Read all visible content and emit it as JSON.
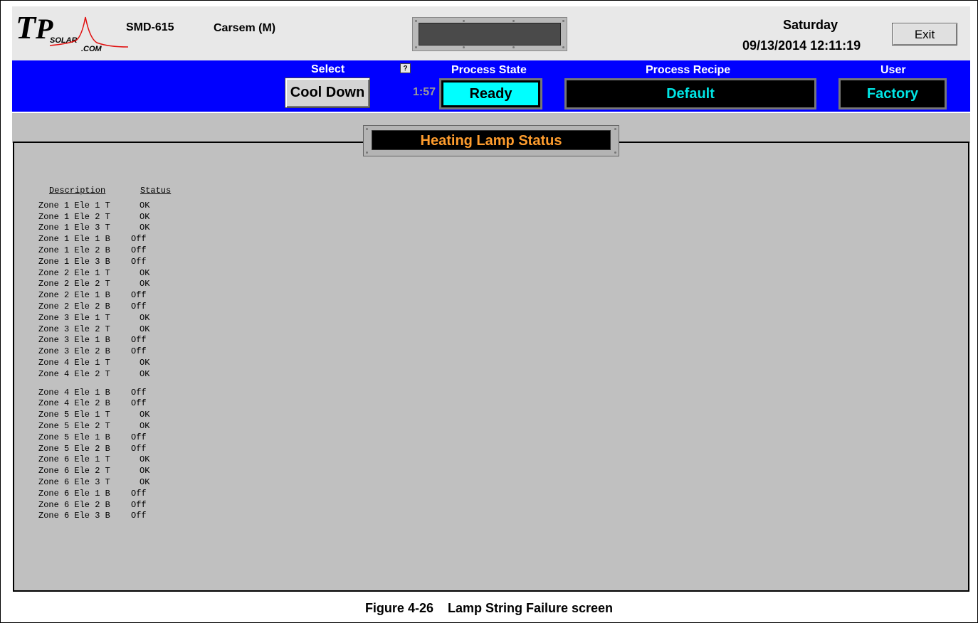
{
  "header": {
    "logo_alt": "TP SOLAR .COM",
    "model": "SMD-615",
    "site": "Carsem (M)",
    "day": "Saturday",
    "datetime": "09/13/2014 12:11:19",
    "exit_label": "Exit"
  },
  "statusbar": {
    "select_label": "Select",
    "select_button": "Cool Down",
    "help_label": "?",
    "timer": "1:57",
    "process_state_label": "Process State",
    "process_state_value": "Ready",
    "process_recipe_label": "Process Recipe",
    "process_recipe_value": "Default",
    "user_label": "User",
    "user_value": "Factory"
  },
  "panel": {
    "title": "Heating Lamp Status",
    "columns": {
      "description": "Description",
      "status": "Status"
    },
    "rows": [
      {
        "d": "Zone 1 Ele 1 T",
        "s": "OK"
      },
      {
        "d": "Zone 1 Ele 2 T",
        "s": "OK"
      },
      {
        "d": "Zone 1 Ele 3 T",
        "s": "OK"
      },
      {
        "d": "Zone 1 Ele 1 B",
        "s": "Off"
      },
      {
        "d": "Zone 1 Ele 2 B",
        "s": "Off"
      },
      {
        "d": "Zone 1 Ele 3 B",
        "s": "Off"
      },
      {
        "d": "Zone 2 Ele 1 T",
        "s": "OK"
      },
      {
        "d": "Zone 2 Ele 2 T",
        "s": "OK"
      },
      {
        "d": "Zone 2 Ele 1 B",
        "s": "Off"
      },
      {
        "d": "Zone 2 Ele 2 B",
        "s": "Off"
      },
      {
        "d": "Zone 3 Ele 1 T",
        "s": "OK"
      },
      {
        "d": "Zone 3 Ele 2 T",
        "s": "OK"
      },
      {
        "d": "Zone 3 Ele 1 B",
        "s": "Off"
      },
      {
        "d": "Zone 3 Ele 2 B",
        "s": "Off"
      },
      {
        "d": "Zone 4 Ele 1 T",
        "s": "OK"
      },
      {
        "d": "Zone 4 Ele 2 T",
        "s": "OK"
      },
      {
        "d": "Zone 4 Ele 1 B",
        "s": "Off",
        "gap": true
      },
      {
        "d": "Zone 4 Ele 2 B",
        "s": "Off"
      },
      {
        "d": "Zone 5 Ele 1 T",
        "s": "OK"
      },
      {
        "d": "Zone 5 Ele 2 T",
        "s": "OK"
      },
      {
        "d": "Zone 5 Ele 1 B",
        "s": "Off"
      },
      {
        "d": "Zone 5 Ele 2 B",
        "s": "Off"
      },
      {
        "d": "Zone 6 Ele 1 T",
        "s": "OK"
      },
      {
        "d": "Zone 6 Ele 2 T",
        "s": "OK"
      },
      {
        "d": "Zone 6 Ele 3 T",
        "s": "OK"
      },
      {
        "d": "Zone 6 Ele 1 B",
        "s": "Off"
      },
      {
        "d": "Zone 6 Ele 2 B",
        "s": "Off"
      },
      {
        "d": "Zone 6 Ele 3 B",
        "s": "Off"
      }
    ]
  },
  "caption": "Figure 4-26    Lamp String Failure screen",
  "colors": {
    "blue_bar": "#0000ff",
    "ready_bg": "#00ffff",
    "field_text": "#00e5e5",
    "title_text": "#ff9d2e",
    "panel_bg": "#c0c0c0"
  }
}
